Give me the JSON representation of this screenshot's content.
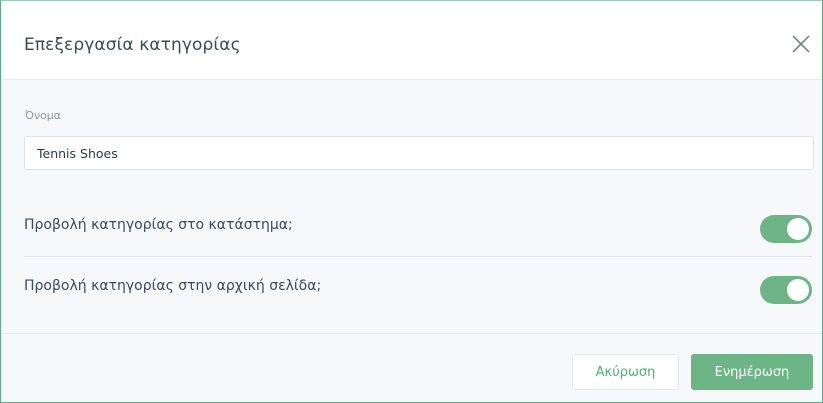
{
  "dialog": {
    "title": "Επεξεργασία κατηγορίας",
    "close_icon": "close-icon"
  },
  "form": {
    "name_label": "Όνομα",
    "name_value": "Tennis Shoes"
  },
  "toggles": [
    {
      "label": "Προβολή κατηγορίας στο κατάστημα;",
      "enabled": true
    },
    {
      "label": "Προβολή κατηγορίας στην αρχική σελίδα;",
      "enabled": true
    }
  ],
  "footer": {
    "cancel_label": "Ακύρωση",
    "update_label": "Ενημέρωση"
  },
  "colors": {
    "accent": "#6db586",
    "border": "#5aa98a"
  }
}
